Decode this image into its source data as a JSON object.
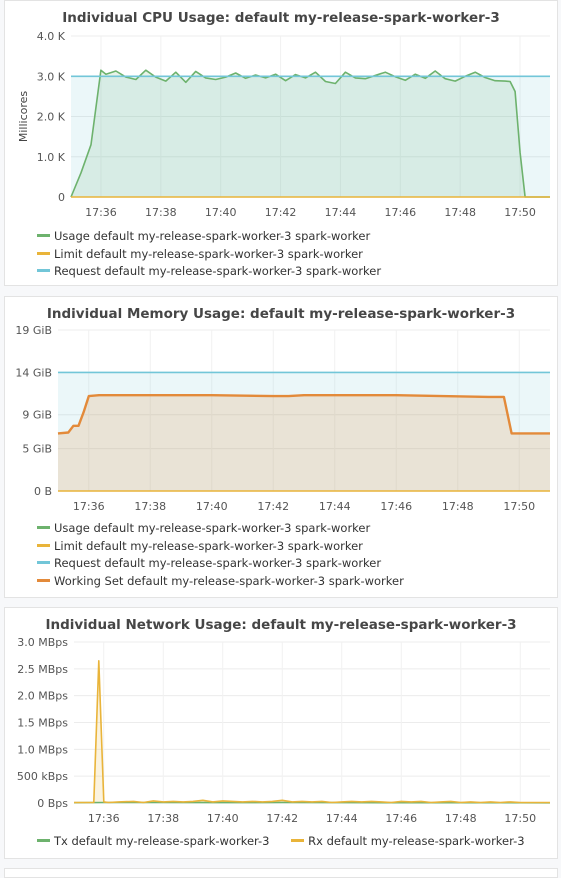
{
  "colors": {
    "usage": "#6db26d",
    "limit": "#e9b43a",
    "request": "#72c6d8",
    "working_set": "#e38a3a",
    "tx": "#6db26d",
    "rx": "#e9b43a"
  },
  "chart_data": [
    {
      "type": "line",
      "title": "Individual CPU Usage: default my-release-spark-worker-3",
      "ylabel": "Millicores",
      "xlabel": "",
      "ylim": [
        0,
        4000
      ],
      "y_ticks": [
        "4.0 K",
        "3.0 K",
        "2.0 K",
        "1.0 K",
        "0"
      ],
      "y_tick_values": [
        4000,
        3000,
        2000,
        1000,
        0
      ],
      "xlim": [
        "17:35",
        "17:51"
      ],
      "x_ticks": [
        "17:36",
        "17:38",
        "17:40",
        "17:42",
        "17:44",
        "17:46",
        "17:48",
        "17:50"
      ],
      "x_tick_values": [
        "17:36",
        "17:38",
        "17:40",
        "17:42",
        "17:44",
        "17:46",
        "17:48",
        "17:50"
      ],
      "grid": true,
      "legend_position": "bottom",
      "series": [
        {
          "name": "Usage default my-release-spark-worker-3 spark-worker",
          "color": "#6db26d",
          "fill": true,
          "x": [
            "17:35:00",
            "17:35:20",
            "17:35:40",
            "17:36:00",
            "17:36:10",
            "17:36:30",
            "17:36:50",
            "17:37:10",
            "17:37:30",
            "17:37:50",
            "17:38:10",
            "17:38:30",
            "17:38:50",
            "17:39:10",
            "17:39:30",
            "17:39:50",
            "17:40:10",
            "17:40:30",
            "17:40:50",
            "17:41:10",
            "17:41:30",
            "17:41:50",
            "17:42:10",
            "17:42:30",
            "17:42:50",
            "17:43:10",
            "17:43:30",
            "17:43:50",
            "17:44:10",
            "17:44:30",
            "17:44:50",
            "17:45:10",
            "17:45:30",
            "17:45:50",
            "17:46:10",
            "17:46:30",
            "17:46:50",
            "17:47:10",
            "17:47:30",
            "17:47:50",
            "17:48:10",
            "17:48:30",
            "17:48:50",
            "17:49:10",
            "17:49:30",
            "17:49:40",
            "17:49:50",
            "17:50:00",
            "17:50:10",
            "17:51:00"
          ],
          "values": [
            0,
            600,
            1300,
            3150,
            3050,
            3130,
            2980,
            2920,
            3150,
            2980,
            2880,
            3100,
            2850,
            3120,
            2960,
            2920,
            2980,
            3080,
            2950,
            3030,
            2960,
            3050,
            2890,
            3040,
            2960,
            3100,
            2870,
            2820,
            3100,
            2960,
            2940,
            3020,
            3100,
            2990,
            2900,
            3050,
            2950,
            3130,
            2940,
            2880,
            3000,
            3100,
            2970,
            2890,
            2880,
            2870,
            2620,
            1100,
            0,
            0
          ]
        },
        {
          "name": "Limit default my-release-spark-worker-3 spark-worker",
          "color": "#e9b43a",
          "fill": false,
          "x": [
            "17:35:00",
            "17:51:00"
          ],
          "values": [
            0,
            0
          ]
        },
        {
          "name": "Request default my-release-spark-worker-3 spark-worker",
          "color": "#72c6d8",
          "fill": true,
          "x": [
            "17:35:00",
            "17:51:00"
          ],
          "values": [
            3000,
            3000
          ]
        }
      ]
    },
    {
      "type": "line",
      "title": "Individual Memory Usage: default my-release-spark-worker-3",
      "ylabel": "",
      "xlabel": "",
      "ylim": [
        0,
        19
      ],
      "y_ticks": [
        "19 GiB",
        "14 GiB",
        "9 GiB",
        "5 GiB",
        "0 B"
      ],
      "y_tick_values": [
        19,
        14,
        9,
        5,
        0
      ],
      "xlim": [
        "17:35",
        "17:51"
      ],
      "x_ticks": [
        "17:36",
        "17:38",
        "17:40",
        "17:42",
        "17:44",
        "17:46",
        "17:48",
        "17:50"
      ],
      "x_tick_values": [
        "17:36",
        "17:38",
        "17:40",
        "17:42",
        "17:44",
        "17:46",
        "17:48",
        "17:50"
      ],
      "grid": true,
      "legend_position": "bottom",
      "series": [
        {
          "name": "Usage default my-release-spark-worker-3 spark-worker",
          "color": "#6db26d",
          "fill": false,
          "x": [
            "17:35:00",
            "17:35:20",
            "17:35:30",
            "17:35:40",
            "17:35:50",
            "17:36:00",
            "17:36:20",
            "17:37:00",
            "17:40:00",
            "17:42:00",
            "17:42:30",
            "17:43:00",
            "17:46:00",
            "17:49:00",
            "17:49:30",
            "17:49:45",
            "17:51:00"
          ],
          "values": [
            6.8,
            6.9,
            7.7,
            7.7,
            9.3,
            11.2,
            11.3,
            11.3,
            11.3,
            11.2,
            11.2,
            11.3,
            11.3,
            11.1,
            11.1,
            6.8,
            6.8
          ]
        },
        {
          "name": "Limit default my-release-spark-worker-3 spark-worker",
          "color": "#e9b43a",
          "fill": false,
          "x": [
            "17:35:00",
            "17:51:00"
          ],
          "values": [
            0,
            0
          ]
        },
        {
          "name": "Request default my-release-spark-worker-3 spark-worker",
          "color": "#72c6d8",
          "fill": true,
          "x": [
            "17:35:00",
            "17:51:00"
          ],
          "values": [
            14,
            14
          ]
        },
        {
          "name": "Working Set default my-release-spark-worker-3 spark-worker",
          "color": "#e38a3a",
          "fill": true,
          "x": [
            "17:35:00",
            "17:35:20",
            "17:35:30",
            "17:35:40",
            "17:35:50",
            "17:36:00",
            "17:36:20",
            "17:37:00",
            "17:40:00",
            "17:42:00",
            "17:42:30",
            "17:43:00",
            "17:46:00",
            "17:49:00",
            "17:49:30",
            "17:49:45",
            "17:51:00"
          ],
          "values": [
            6.8,
            6.9,
            7.7,
            7.7,
            9.3,
            11.2,
            11.3,
            11.3,
            11.3,
            11.2,
            11.2,
            11.3,
            11.3,
            11.1,
            11.1,
            6.8,
            6.8
          ]
        }
      ]
    },
    {
      "type": "line",
      "title": "Individual Network Usage: default my-release-spark-worker-3",
      "ylabel": "",
      "xlabel": "",
      "ylim": [
        0,
        3.0
      ],
      "y_ticks": [
        "3.0 MBps",
        "2.5 MBps",
        "2.0 MBps",
        "1.5 MBps",
        "1.0 MBps",
        "500 kBps",
        "0 Bps"
      ],
      "y_tick_values": [
        3.0,
        2.5,
        2.0,
        1.5,
        1.0,
        0.5,
        0
      ],
      "xlim": [
        "17:35",
        "17:51"
      ],
      "x_ticks": [
        "17:36",
        "17:38",
        "17:40",
        "17:42",
        "17:44",
        "17:46",
        "17:48",
        "17:50"
      ],
      "x_tick_values": [
        "17:36",
        "17:38",
        "17:40",
        "17:42",
        "17:44",
        "17:46",
        "17:48",
        "17:50"
      ],
      "grid": true,
      "legend_position": "bottom",
      "series": [
        {
          "name": "Tx default my-release-spark-worker-3",
          "color": "#6db26d",
          "fill": false,
          "x": [
            "17:35:00",
            "17:36:00",
            "17:38:00",
            "17:40:00",
            "17:42:00",
            "17:44:00",
            "17:46:00",
            "17:48:00",
            "17:51:00"
          ],
          "values": [
            0.005,
            0.01,
            0.01,
            0.008,
            0.01,
            0.008,
            0.006,
            0.005,
            0.003
          ]
        },
        {
          "name": "Rx default my-release-spark-worker-3",
          "color": "#e9b43a",
          "fill": true,
          "x": [
            "17:35:00",
            "17:35:40",
            "17:35:50",
            "17:36:00",
            "17:36:10",
            "17:36:30",
            "17:37:00",
            "17:37:20",
            "17:37:40",
            "17:38:00",
            "17:38:20",
            "17:38:40",
            "17:39:00",
            "17:39:20",
            "17:39:40",
            "17:40:00",
            "17:40:20",
            "17:40:40",
            "17:41:00",
            "17:41:20",
            "17:41:40",
            "17:42:00",
            "17:42:20",
            "17:42:40",
            "17:43:00",
            "17:43:20",
            "17:43:40",
            "17:44:00",
            "17:44:20",
            "17:44:40",
            "17:45:00",
            "17:45:20",
            "17:45:40",
            "17:46:00",
            "17:46:20",
            "17:46:40",
            "17:47:00",
            "17:47:20",
            "17:47:40",
            "17:48:00",
            "17:48:20",
            "17:48:40",
            "17:49:00",
            "17:49:20",
            "17:49:40",
            "17:50:00",
            "17:50:20",
            "17:51:00"
          ],
          "values": [
            0.01,
            0.01,
            2.65,
            0.02,
            0.01,
            0.02,
            0.03,
            0.01,
            0.04,
            0.02,
            0.03,
            0.02,
            0.03,
            0.05,
            0.02,
            0.04,
            0.03,
            0.02,
            0.03,
            0.02,
            0.03,
            0.05,
            0.02,
            0.03,
            0.02,
            0.03,
            0.01,
            0.02,
            0.03,
            0.02,
            0.03,
            0.02,
            0.01,
            0.03,
            0.02,
            0.03,
            0.01,
            0.02,
            0.03,
            0.01,
            0.02,
            0.01,
            0.02,
            0.01,
            0.02,
            0.01,
            0.01,
            0.01
          ]
        }
      ]
    }
  ]
}
